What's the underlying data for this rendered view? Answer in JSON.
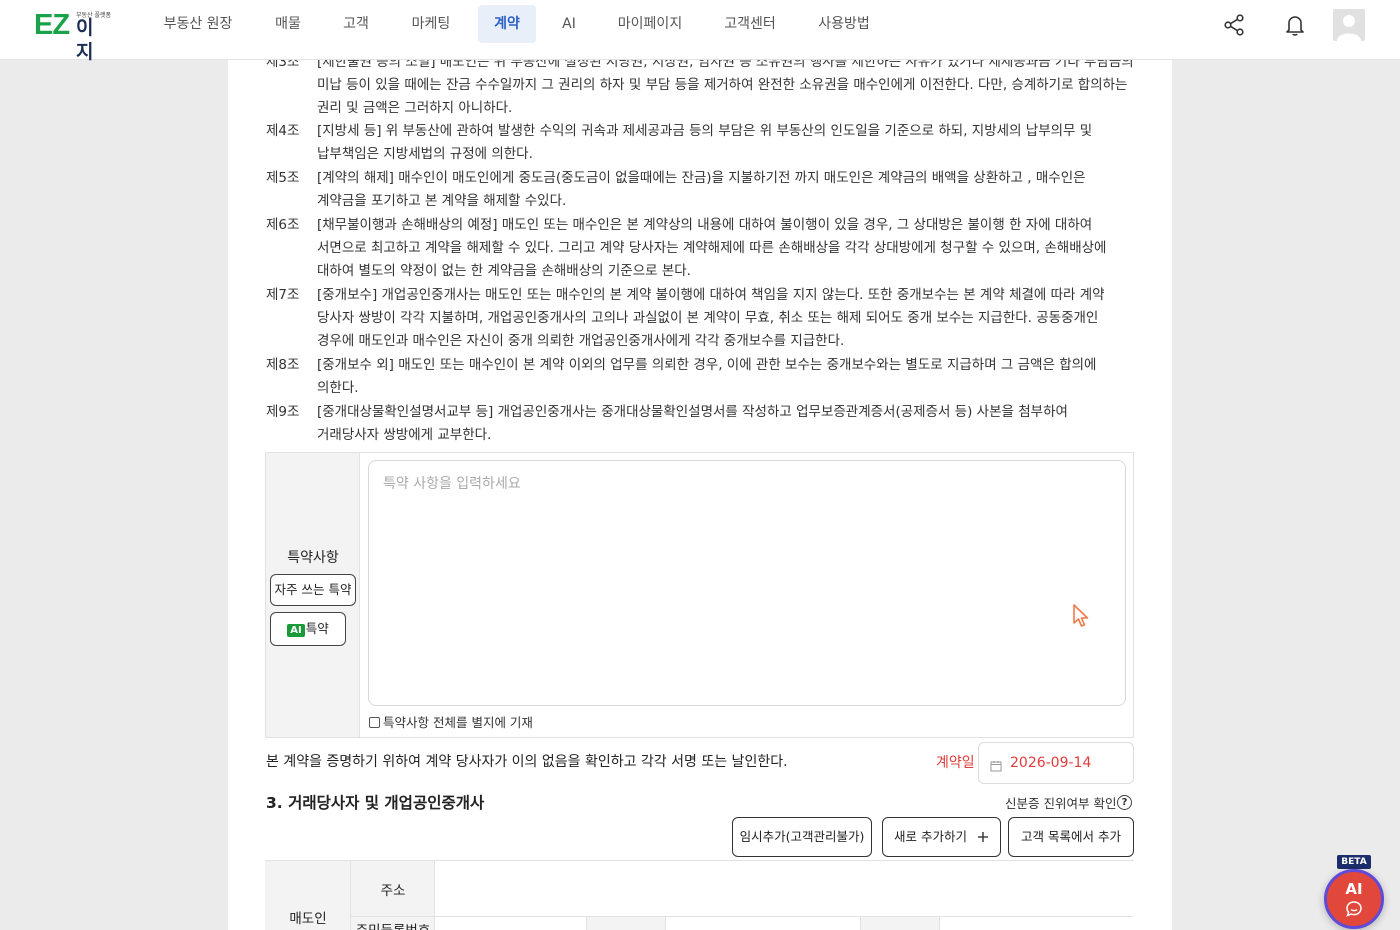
{
  "brand": {
    "logo_ez": "EZ",
    "logo_small": "부동산 플랫폼",
    "logo_main": "이지"
  },
  "nav": {
    "items": [
      {
        "label": "부동산 원장"
      },
      {
        "label": "매물"
      },
      {
        "label": "고객"
      },
      {
        "label": "마케팅"
      },
      {
        "label": "계약",
        "active": true
      },
      {
        "label": "AI"
      },
      {
        "label": "마이페이지"
      },
      {
        "label": "고객센터"
      },
      {
        "label": "사용방법"
      }
    ],
    "icons": [
      "share-icon",
      "bell-icon",
      "user-avatar-icon"
    ]
  },
  "articles": [
    {
      "num": "제3조",
      "lines": [
        "[제한물권 등의 소멸] 매도인은 위 부동산에 설정된 저당권, 지상권, 임차권 등 소유권의 행사를 제한하는 사유가 있거나 제세공과금 기타 부담금의",
        "미납 등이 있을 때에는 잔금 수수일까지 그 권리의 하자 및 부담 등을 제거하여 완전한 소유권을 매수인에게 이전한다. 다만, 승계하기로 합의하는",
        "권리 및 금액은 그러하지 아니하다."
      ]
    },
    {
      "num": "제4조",
      "lines": [
        "[지방세 등] 위 부동산에 관하여 발생한 수익의 귀속과 제세공과금 등의 부담은 위 부동산의 인도일을 기준으로 하되, 지방세의 납부의무 및",
        "납부책임은 지방세법의 규정에 의한다."
      ]
    },
    {
      "num": "제5조",
      "lines": [
        "[계약의 해제] 매수인이 매도인에게 중도금(중도금이 없을때에는 잔금)을 지불하기전 까지 매도인은 계약금의 배액을 상환하고 , 매수인은",
        "계약금을 포기하고 본 계약을 해제할 수있다."
      ]
    },
    {
      "num": "제6조",
      "lines": [
        "[채무불이행과 손해배상의 예정] 매도인 또는 매수인은 본 계약상의 내용에 대하여 불이행이 있을 경우, 그 상대방은 불이행 한 자에 대하여",
        "서면으로 최고하고 계약을 해제할 수 있다. 그리고 계약 당사자는 계약해제에 따른 손해배상을 각각 상대방에게 청구할 수 있으며, 손해배상에",
        "대하여 별도의 약정이 없는 한 계약금을 손해배상의 기준으로 본다."
      ]
    },
    {
      "num": "제7조",
      "lines": [
        "[중개보수] 개업공인중개사는 매도인 또는 매수인의 본 계약 불이행에 대하여 책임을 지지 않는다. 또한 중개보수는 본 계약 체결에 따라 계약",
        "당사자 쌍방이 각각 지불하며, 개업공인중개사의 고의나 과실없이 본 계약이 무효, 취소 또는 해제 되어도 중개 보수는 지급한다. 공동중개인",
        "경우에 매도인과 매수인은 자신이 중개 의뢰한 개업공인중개사에게 각각 중개보수를 지급한다."
      ]
    },
    {
      "num": "제8조",
      "lines": [
        "[중개보수 외] 매도인 또는 매수인이 본 계약 이외의 업무를 의뢰한 경우, 이에 관한 보수는 중개보수와는 별도로 지급하며 그 금액은 합의에",
        "의한다."
      ]
    },
    {
      "num": "제9조",
      "lines": [
        "[중개대상물확인설명서교부 등] 개업공인중개사는 중개대상물확인설명서를 작성하고 업무보증관계증서(공제증서 등) 사본을 첨부하여",
        "거래당사자 쌍방에게 교부한다."
      ]
    }
  ],
  "special_terms": {
    "title": "특약사항",
    "frequent_button": "자주 쓰는 특약",
    "ai_badge": "AI",
    "ai_button": "특약",
    "placeholder": "특약 사항을 입력하세요",
    "separate_checkbox": "특약사항 전체를 별지에 기재",
    "separate_checked": false
  },
  "signature": {
    "statement": "본 계약을 증명하기 위하여 계약 당사자가 이의 없음을 확인하고 각각 서명 또는 날인한다.",
    "date_label": "계약일",
    "date_value": "2026-09-14"
  },
  "parties": {
    "section_title": "3. 거래당사자 및 개업공인중개사",
    "verify_label": "신분증 진위여부 확인",
    "buttons": {
      "temp_add": "임시추가(고객관리불가)",
      "new_add": "새로 추가하기",
      "from_list": "고객 목록에서 추가"
    },
    "table": {
      "seller": "매도인",
      "address": "주소",
      "resident_no": "주민등록번호"
    }
  },
  "ai_fab": {
    "beta": "BETA",
    "label": "AI"
  }
}
